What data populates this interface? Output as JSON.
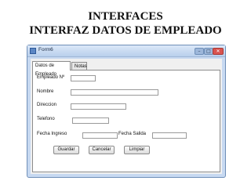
{
  "slide": {
    "title_line1": "INTERFACES",
    "title_line2": "INTERFAZ DATOS DE EMPLEADO"
  },
  "window": {
    "title": "Form6",
    "controls": {
      "minimize": "–",
      "maximize": "□",
      "close": "✕"
    }
  },
  "tabs": [
    {
      "label": "Datos de Empleado",
      "selected": true
    },
    {
      "label": "Notas",
      "selected": false
    }
  ],
  "form": {
    "labels": {
      "empleado_no": "Empleado Nº",
      "nombre": "Nombre",
      "direccion": "Direccion",
      "telefono": "Telefono",
      "fecha_ingreso": "Fecha Ingreso",
      "fecha_salida": "Fecha Salida"
    },
    "values": {
      "empleado_no": "",
      "nombre": "",
      "direccion": "",
      "telefono": "",
      "fecha_ingreso": "",
      "fecha_salida": ""
    }
  },
  "buttons": {
    "guardar": "Guardar",
    "cancelar": "Cancelar",
    "limpiar": "Limpiar"
  }
}
